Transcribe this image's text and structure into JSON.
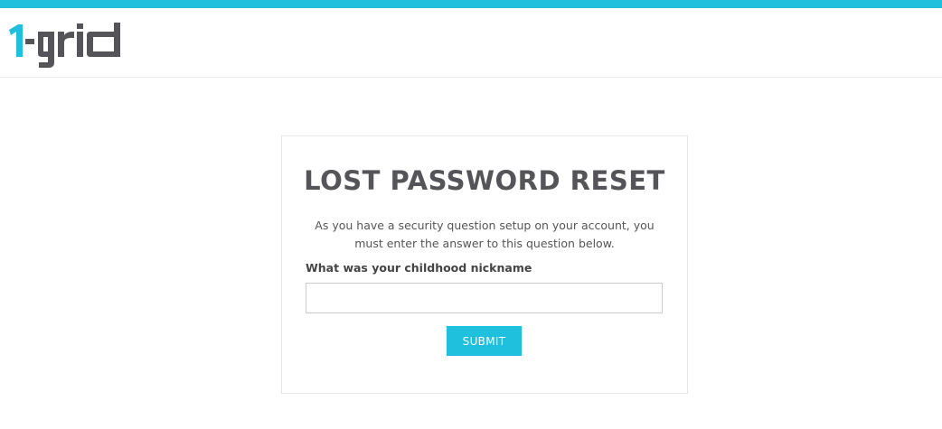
{
  "brand": {
    "logo_text_prefix": "1",
    "logo_text_suffix": "-grid",
    "accent_color": "#1fc0dd",
    "text_color": "#555459"
  },
  "reset_card": {
    "title": "LOST PASSWORD RESET",
    "description": "As you have a security question setup on your account, you must enter the answer to this question below.",
    "question_label": "What was your childhood nickname",
    "answer_value": "",
    "submit_label": "SUBMIT"
  }
}
